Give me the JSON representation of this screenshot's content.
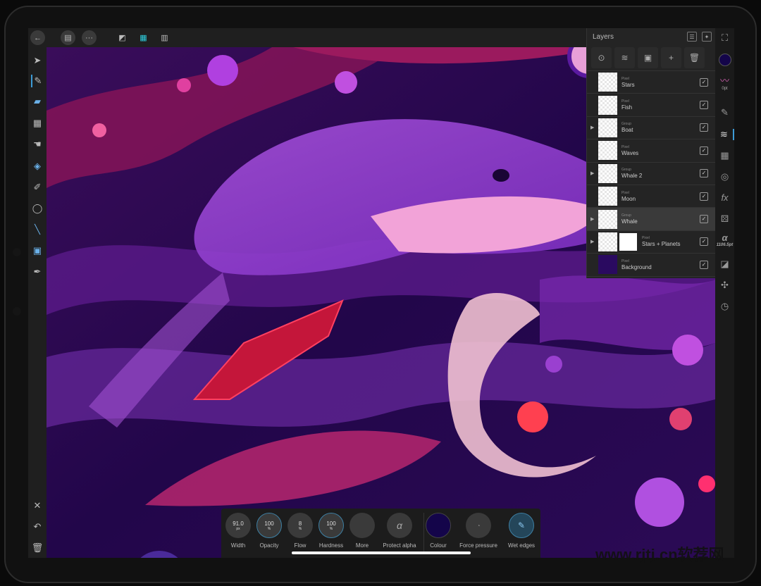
{
  "colors": {
    "accent": "#3d9bd6",
    "current_colour": "#14054a",
    "panel": "#242424"
  },
  "topbar": {
    "icons": [
      "back-icon",
      "document-icon",
      "more-icon",
      "designer-persona-icon",
      "pixel-persona-icon",
      "export-persona-icon"
    ]
  },
  "left_tools": [
    "move-tool",
    "paint-brush-tool",
    "erase-brush-tool",
    "pixel-selection-tool",
    "smudge-tool",
    "flood-fill-tool",
    "color-picker-brush-tool",
    "lasso-tool",
    "line-tool",
    "selection-brush-tool",
    "eyedropper-tool"
  ],
  "layers": {
    "title": "Layers",
    "items": [
      {
        "type": "Pixel",
        "name": "Stars",
        "group": false,
        "visible": true
      },
      {
        "type": "Pixel",
        "name": "Fish",
        "group": false,
        "visible": true
      },
      {
        "type": "Group",
        "name": "Boat",
        "group": true,
        "visible": true
      },
      {
        "type": "Pixel",
        "name": "Waves",
        "group": false,
        "visible": true
      },
      {
        "type": "Group",
        "name": "Whale 2",
        "group": true,
        "visible": true
      },
      {
        "type": "Pixel",
        "name": "Moon",
        "group": false,
        "visible": true
      },
      {
        "type": "Group",
        "name": "Whale",
        "group": true,
        "visible": true,
        "selected": true
      },
      {
        "type": "Pixel",
        "name": "Stars + Planets",
        "group": true,
        "visible": true,
        "mask": true
      },
      {
        "type": "Pixel",
        "name": "Background",
        "group": false,
        "visible": true
      }
    ]
  },
  "right_tools": {
    "brush_size": "0pt",
    "font_size": "1106.5pt"
  },
  "context_toolbar": {
    "width": {
      "value": "91.0",
      "unit": "px",
      "label": "Width"
    },
    "opacity": {
      "value": "100",
      "unit": "%",
      "label": "Opacity"
    },
    "flow": {
      "value": "8",
      "unit": "%",
      "label": "Flow"
    },
    "hardness": {
      "value": "100",
      "unit": "%",
      "label": "Hardness"
    },
    "more": {
      "label": "More"
    },
    "protect_alpha": {
      "glyph": "α",
      "label": "Protect alpha"
    },
    "colour": {
      "label": "Colour"
    },
    "force_pressure": {
      "label": "Force pressure"
    },
    "wet_edges": {
      "label": "Wet edges"
    }
  },
  "watermark": "www.rjtj.cn软荐网"
}
